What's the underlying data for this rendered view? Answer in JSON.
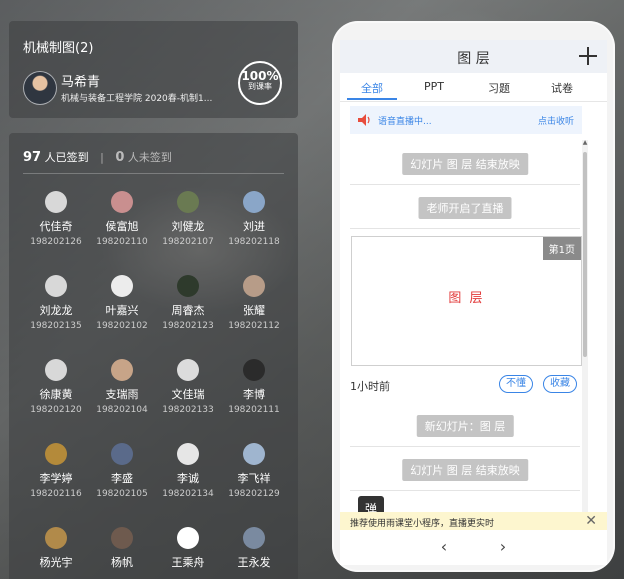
{
  "course": {
    "title": "机械制图(2)",
    "teacher_name": "马希青",
    "teacher_org": "机械与装备工程学院 2020春-机制1...",
    "rate_value": "100%",
    "rate_label": "到课率"
  },
  "attendance": {
    "checked_count": "97",
    "checked_label": "人已签到",
    "separator": "|",
    "unchecked_count": "0",
    "unchecked_label": "人未签到",
    "students": [
      {
        "name": "代佳奇",
        "id": "198202126",
        "color": "#d8d8d8"
      },
      {
        "name": "侯富旭",
        "id": "198202110",
        "color": "#c98f8f"
      },
      {
        "name": "刘健龙",
        "id": "198202107",
        "color": "#6a7a52"
      },
      {
        "name": "刘进",
        "id": "198202118",
        "color": "#8aa6c8"
      },
      {
        "name": "刘龙龙",
        "id": "198202135",
        "color": "#d8d8d8"
      },
      {
        "name": "叶嘉兴",
        "id": "198202102",
        "color": "#ececec"
      },
      {
        "name": "周睿杰",
        "id": "198202123",
        "color": "#2e3a2c"
      },
      {
        "name": "张耀",
        "id": "198202112",
        "color": "#b79c88"
      },
      {
        "name": "徐康黄",
        "id": "198202120",
        "color": "#d8d8d8"
      },
      {
        "name": "支瑞雨",
        "id": "198202104",
        "color": "#c7a488"
      },
      {
        "name": "文佳瑞",
        "id": "198202133",
        "color": "#dcdcdc"
      },
      {
        "name": "李博",
        "id": "198202111",
        "color": "#2b2b2b"
      },
      {
        "name": "李学婷",
        "id": "198202116",
        "color": "#b48a3a"
      },
      {
        "name": "李盛",
        "id": "198202105",
        "color": "#5a6a8a"
      },
      {
        "name": "李诚",
        "id": "198202134",
        "color": "#e6e6e6"
      },
      {
        "name": "李飞祥",
        "id": "198202129",
        "color": "#9fb5cf"
      },
      {
        "name": "杨光宇",
        "id": "",
        "color": "#b18a4a"
      },
      {
        "name": "杨帆",
        "id": "",
        "color": "#6e5a4e"
      },
      {
        "name": "王乘舟",
        "id": "",
        "color": "#ffffff"
      },
      {
        "name": "王永发",
        "id": "",
        "color": "#7a8aa0"
      }
    ]
  },
  "phone": {
    "title": "图 层",
    "tabs": [
      "全部",
      "PPT",
      "习题",
      "试卷"
    ],
    "active_tab": "全部",
    "live_text": "语音直播中...",
    "live_action": "点击收听",
    "feed": [
      "幻灯片 图 层 结束放映",
      "老师开启了直播"
    ],
    "slide": {
      "page": "第1页",
      "text": "图 层"
    },
    "time_ago": "1小时前",
    "chip_dont_understand": "不懂",
    "chip_collect": "收藏",
    "feed_after": [
      "新幻灯片：图 层",
      "幻灯片 图 层 结束放映"
    ],
    "toast": "弹",
    "promo_text": "推荐使用雨课堂小程序，直播更实时",
    "colors": {
      "accent": "#3a85e6",
      "slide_text": "#e23a3a"
    }
  }
}
